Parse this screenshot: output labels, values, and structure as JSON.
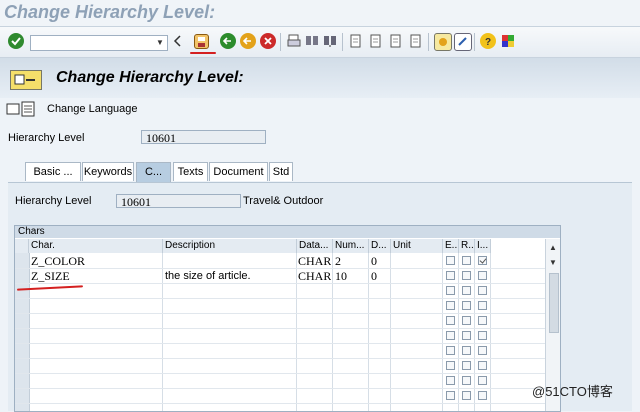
{
  "window": {
    "title": "Change Hierarchy Level:"
  },
  "toolbar": {
    "command_placeholder": "",
    "icons": [
      "check-icon",
      "back-arrow-icon",
      "save-icon",
      "green-back-icon",
      "exit-icon",
      "cancel-icon",
      "print-icon",
      "find-icon",
      "find-next-icon",
      "first-page-icon",
      "previous-page-icon",
      "next-page-icon",
      "last-page-icon",
      "new-session-icon",
      "shortcut-icon",
      "help-icon",
      "customize-layout-icon"
    ]
  },
  "page": {
    "title": "Change Hierarchy Level:"
  },
  "app_toolbar": {
    "change_language": "Change Language"
  },
  "hierarchy_level": {
    "label": "Hierarchy Level",
    "value": "10601"
  },
  "tabs": [
    {
      "label": "Basic ...",
      "active": false
    },
    {
      "label": "Keywords",
      "active": false
    },
    {
      "label": "C...",
      "active": true
    },
    {
      "label": "Texts",
      "active": false
    },
    {
      "label": "Document",
      "active": false
    },
    {
      "label": "Std",
      "active": false
    }
  ],
  "tab_content": {
    "hierarchy_label": "Hierarchy Level",
    "hierarchy_value": "10601",
    "hierarchy_desc": "Travel& Outdoor"
  },
  "chars_table": {
    "title": "Chars",
    "columns": [
      "Char.",
      "Description",
      "Data...",
      "Num...",
      "D...",
      "Unit",
      "E...",
      "R...",
      "I..."
    ],
    "rows": [
      {
        "char": "Z_COLOR",
        "description": "",
        "data_type": "CHAR",
        "num": "2",
        "dec": "0",
        "unit": "",
        "e": false,
        "r": false,
        "i": true
      },
      {
        "char": "Z_SIZE",
        "description": "the size of article.",
        "data_type": "CHAR",
        "num": "10",
        "dec": "0",
        "unit": "",
        "e": false,
        "r": false,
        "i": false
      }
    ]
  },
  "watermark": "@51CTO博客",
  "colors": {
    "accent_red": "#d42020",
    "tab_active": "#b7cde1",
    "panel_bg": "#e4ecf3"
  }
}
